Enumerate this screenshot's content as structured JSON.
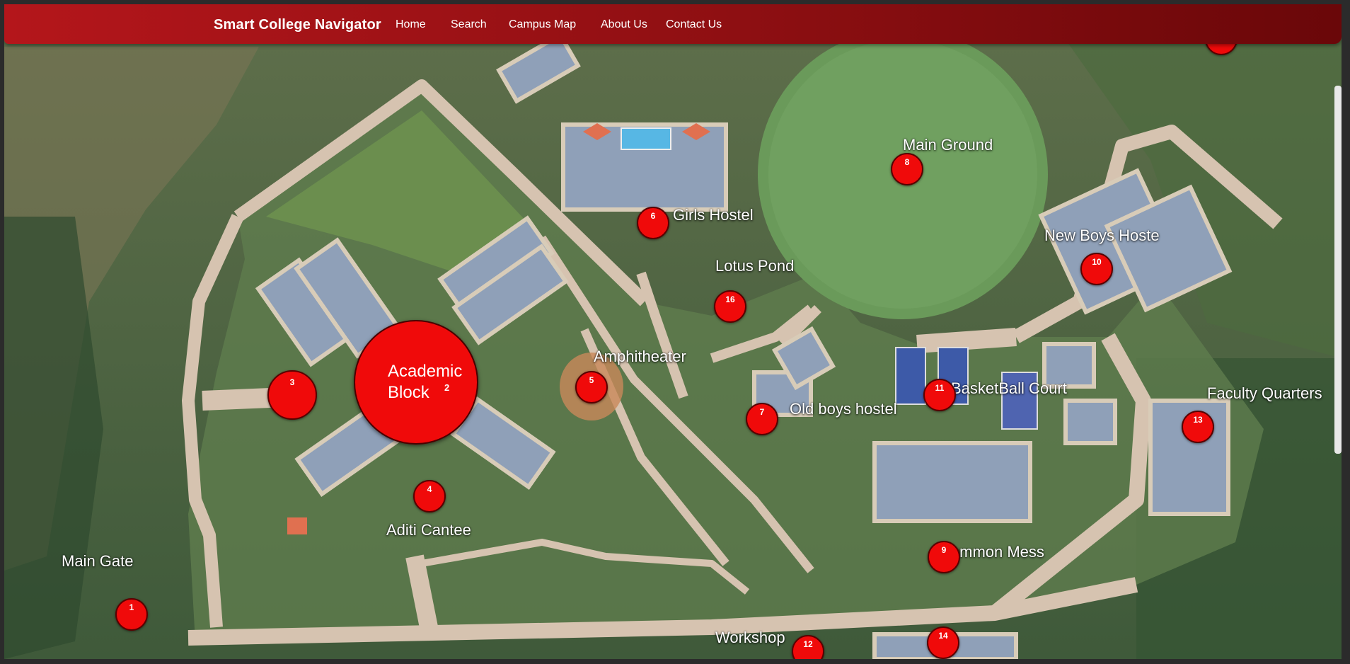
{
  "navbar": {
    "brand": "Smart College Navigator",
    "links": [
      "Home",
      "Search",
      "Campus Map",
      "About Us",
      "Contact Us"
    ],
    "color": "#b4161b"
  },
  "map": {
    "marker_color": "#f00a0a",
    "labels": {
      "main_gate": "Main Gate",
      "academic_block": "Academic Block",
      "aditi_canteen": "Aditi Cantee",
      "amphitheater": "Amphitheater",
      "girls_hostel": "Girls Hostel",
      "lotus_pond": "Lotus Pond",
      "main_ground": "Main Ground",
      "old_boys_hostel": "Old boys hostel",
      "basketball_court": "BasketBall Court",
      "common_mess": "Common Mess",
      "new_boys_hostel": "New Boys Hoste",
      "faculty_quarters": "Faculty Quarters",
      "workshop": "Workshop"
    },
    "markers": {
      "m1": "1",
      "m2": "2",
      "m3": "3",
      "m4": "4",
      "m5": "5",
      "m6": "6",
      "m7": "7",
      "m8": "8",
      "m9": "9",
      "m10": "10",
      "m11": "11",
      "m12": "12",
      "m13": "13",
      "m14": "14",
      "m16": "16"
    },
    "academic_line1": "Academic",
    "academic_line2": "Block"
  }
}
